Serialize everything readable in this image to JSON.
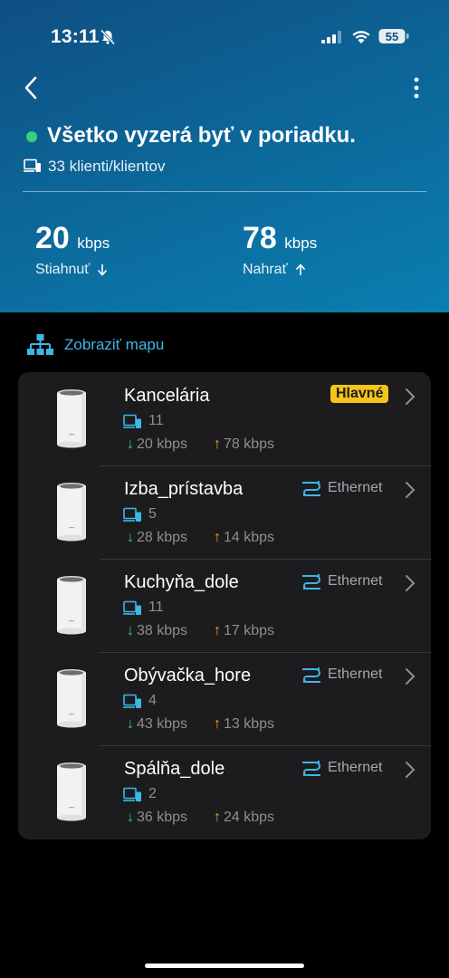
{
  "status_bar": {
    "time": "13:11",
    "battery": "55"
  },
  "header": {
    "status_title": "Všetko vyzerá byť v poriadku.",
    "clients_text": "33 klienti/klientov",
    "download": {
      "value": "20",
      "unit": "kbps",
      "label": "Stiahnuť"
    },
    "upload": {
      "value": "78",
      "unit": "kbps",
      "label": "Nahrať"
    }
  },
  "map_link": {
    "label": "Zobraziť mapu"
  },
  "colors": {
    "accent": "#3eb6e6",
    "ok": "#39d07a",
    "down": "#3fcf6a",
    "up": "#f0a52a",
    "badge": "#f5c518"
  },
  "devices": [
    {
      "name": "Kancelária",
      "badge": "Hlavné",
      "clients": "11",
      "down": "20 kbps",
      "up": "78 kbps"
    },
    {
      "name": "Izba_prístavba",
      "badge": "Ethernet",
      "clients": "5",
      "down": "28 kbps",
      "up": "14 kbps"
    },
    {
      "name": "Kuchyňa_dole",
      "badge": "Ethernet",
      "clients": "11",
      "down": "38 kbps",
      "up": "17 kbps"
    },
    {
      "name": "Obývačka_hore",
      "badge": "Ethernet",
      "clients": "4",
      "down": "43 kbps",
      "up": "13 kbps"
    },
    {
      "name": "Spálňa_dole",
      "badge": "Ethernet",
      "clients": "2",
      "down": "36 kbps",
      "up": "24 kbps"
    }
  ]
}
